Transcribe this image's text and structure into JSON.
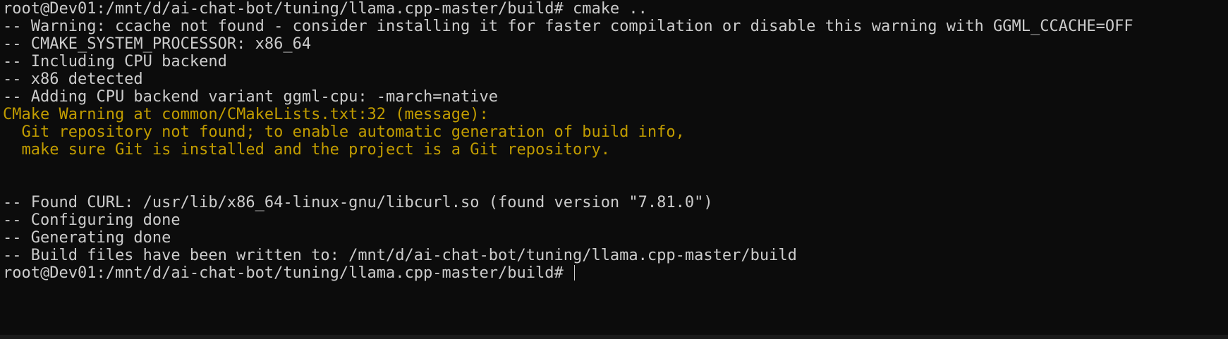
{
  "terminal": {
    "lines": [
      {
        "type": "prompt",
        "text": "root@Dev01:/mnt/d/ai-chat-bot/tuning/llama.cpp-master/build# cmake .."
      },
      {
        "type": "normal",
        "text": "-- Warning: ccache not found - consider installing it for faster compilation or disable this warning with GGML_CCACHE=OFF"
      },
      {
        "type": "normal",
        "text": "-- CMAKE_SYSTEM_PROCESSOR: x86_64"
      },
      {
        "type": "normal",
        "text": "-- Including CPU backend"
      },
      {
        "type": "normal",
        "text": "-- x86 detected"
      },
      {
        "type": "normal",
        "text": "-- Adding CPU backend variant ggml-cpu: -march=native"
      },
      {
        "type": "warn",
        "text": "CMake Warning at common/CMakeLists.txt:32 (message):"
      },
      {
        "type": "warn",
        "text": "  Git repository not found; to enable automatic generation of build info,"
      },
      {
        "type": "warn",
        "text": "  make sure Git is installed and the project is a Git repository."
      },
      {
        "type": "blank",
        "text": ""
      },
      {
        "type": "blank",
        "text": ""
      },
      {
        "type": "normal",
        "text": "-- Found CURL: /usr/lib/x86_64-linux-gnu/libcurl.so (found version \"7.81.0\")"
      },
      {
        "type": "normal",
        "text": "-- Configuring done"
      },
      {
        "type": "normal",
        "text": "-- Generating done"
      },
      {
        "type": "normal",
        "text": "-- Build files have been written to: /mnt/d/ai-chat-bot/tuning/llama.cpp-master/build"
      },
      {
        "type": "prompt",
        "text": "root@Dev01:/mnt/d/ai-chat-bot/tuning/llama.cpp-master/build# "
      }
    ]
  },
  "colors": {
    "background": "#0c0c0c",
    "text": "#cccccc",
    "warning": "#c19c00"
  }
}
